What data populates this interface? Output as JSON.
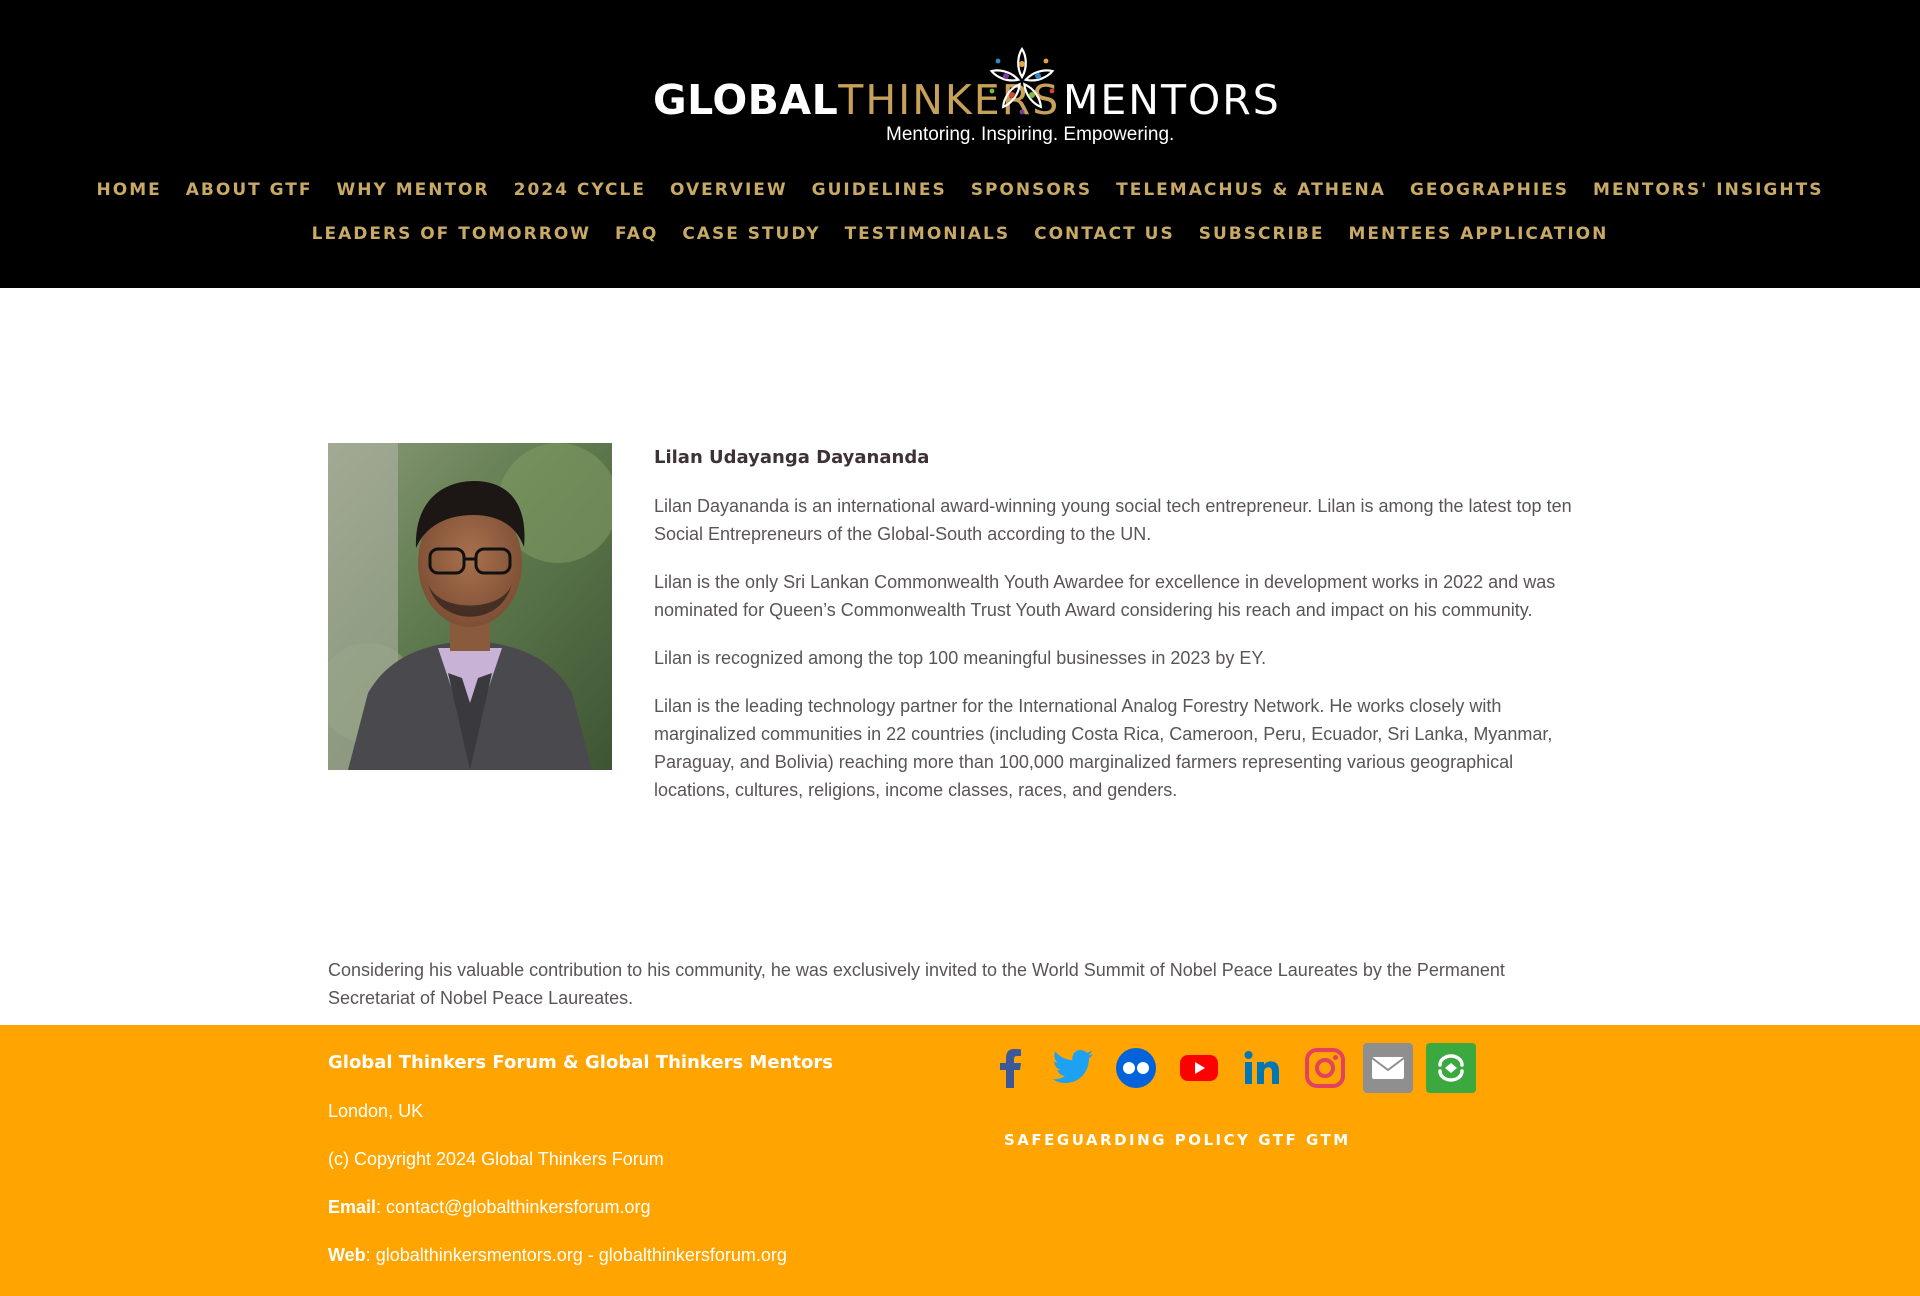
{
  "header": {
    "logo": {
      "word_global": "GLOBAL",
      "word_thinkers": "THINKERS",
      "word_mentors": "MENTORS",
      "tagline": "Mentoring. Inspiring. Empowering."
    },
    "nav_row_1": [
      {
        "label": "HOME"
      },
      {
        "label": "ABOUT GTF"
      },
      {
        "label": "WHY MENTOR"
      },
      {
        "label": "2024 CYCLE"
      },
      {
        "label": "OVERVIEW"
      },
      {
        "label": "GUIDELINES"
      },
      {
        "label": "SPONSORS"
      },
      {
        "label": "TELEMACHUS & ATHENA"
      },
      {
        "label": "GEOGRAPHIES"
      },
      {
        "label": "MENTORS' INSIGHTS"
      }
    ],
    "nav_row_2": [
      {
        "label": "LEADERS OF TOMORROW"
      },
      {
        "label": "FAQ"
      },
      {
        "label": "CASE STUDY"
      },
      {
        "label": "TESTIMONIALS"
      },
      {
        "label": "CONTACT US"
      },
      {
        "label": "SUBSCRIBE"
      },
      {
        "label": "MENTEES APPLICATION"
      }
    ]
  },
  "profile": {
    "name": "Lilan Udayanga Dayananda",
    "paragraphs": [
      "Lilan Dayananda is an international award-winning young social tech entrepreneur. Lilan is among the latest top ten Social Entrepreneurs of the Global-South according to the UN.",
      "Lilan is the only Sri Lankan Commonwealth Youth Awardee for excellence in development works in 2022 and was nominated for Queen’s Commonwealth Trust Youth Award considering his reach and impact on his community.",
      "Lilan is recognized among the top 100 meaningful businesses in 2023 by EY.",
      "Lilan is the leading technology partner for the International Analog Forestry Network. He works closely with marginalized communities in 22 countries (including Costa Rica, Cameroon, Peru, Ecuador, Sri Lanka, Myanmar, Paraguay, and Bolivia) reaching more than 100,000 marginalized farmers representing various geographical locations, cultures, religions, income classes, races, and genders."
    ],
    "closing": "Considering his valuable contribution to his community, he was exclusively invited to the World Summit of Nobel Peace Laureates by the Permanent Secretariat of Nobel Peace Laureates."
  },
  "footer": {
    "org_title": "Global Thinkers Forum & Global Thinkers Mentors",
    "location": "London, UK",
    "copyright": "(c) Copyright 2024 Global Thinkers Forum",
    "email_label": "Email",
    "email_sep": ": ",
    "email_value": "contact@globalthinkersforum.org",
    "web_label": "Web",
    "web_sep": ": ",
    "web_link_1": "globalthinkersmentors.org",
    "web_dash": " - ",
    "web_link_2": "globalthinkersforum.org",
    "safeguarding_link": "SAFEGUARDING POLICY GTF GTM",
    "socials": [
      {
        "icon": "facebook-icon",
        "color": "#3b5998"
      },
      {
        "icon": "twitter-icon",
        "color": "#1da1f2"
      },
      {
        "icon": "flickr-icon",
        "color": "#0063dc"
      },
      {
        "icon": "youtube-icon",
        "color": "#ff0000"
      },
      {
        "icon": "linkedin-icon",
        "color": "#0077b5"
      },
      {
        "icon": "instagram-icon",
        "color": "#e4405f"
      },
      {
        "icon": "email-icon",
        "color": "#8f8f8f"
      },
      {
        "icon": "share-icon",
        "color": "#3ba840"
      }
    ]
  },
  "colors": {
    "header_bg": "#000000",
    "nav_gold": "#c8a966",
    "footer_bg": "#ffa400",
    "text_body": "#5a5458"
  }
}
